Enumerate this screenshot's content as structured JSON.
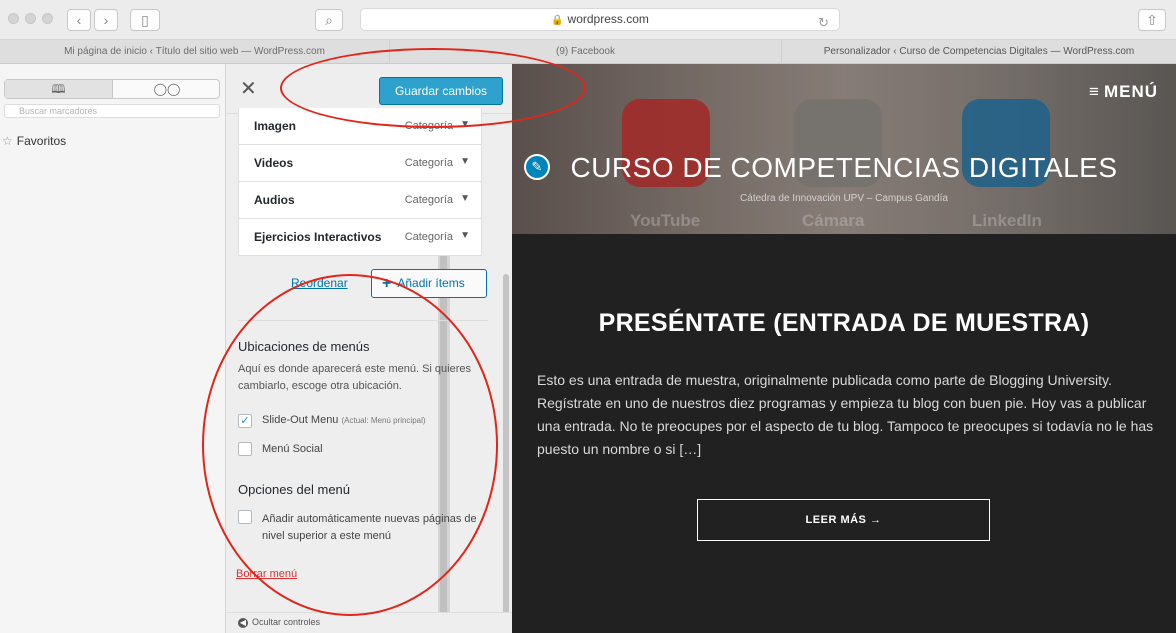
{
  "browser": {
    "address": "wordpress.com",
    "tabs": [
      "Mi página de inicio ‹ Título del sitio web — WordPress.com",
      "(9) Facebook",
      "Personalizador ‹ Curso de Competencias Digitales — WordPress.com"
    ]
  },
  "safari_sidebar": {
    "search_placeholder": "Buscar marcadores",
    "favorites_label": "Favoritos"
  },
  "customizer": {
    "save_label": "Guardar cambios",
    "menu_items": [
      {
        "name": "Imagen",
        "type": "Categoría"
      },
      {
        "name": "Videos",
        "type": "Categoría"
      },
      {
        "name": "Audios",
        "type": "Categoría"
      },
      {
        "name": "Ejercicios Interactivos",
        "type": "Categoría"
      }
    ],
    "reorder_label": "Reordenar",
    "add_items_label": "Añadir ítems",
    "locations": {
      "title": "Ubicaciones de menús",
      "description": "Aquí es donde aparecerá este menú. Si quieres cambiarlo, escoge otra ubicación.",
      "options": [
        {
          "label": "Slide-Out Menu",
          "note": "(Actual: Menú principal)",
          "checked": true
        },
        {
          "label": "Menú Social",
          "note": "",
          "checked": false
        }
      ]
    },
    "menu_options": {
      "title": "Opciones del menú",
      "auto_add_label": "Añadir automáticamente nuevas páginas de nivel superior a este menú",
      "auto_add_checked": false
    },
    "delete_label": "Borrar menú",
    "hide_controls_label": "Ocultar controles"
  },
  "preview": {
    "menu_label": "MENÚ",
    "site_title": "CURSO DE COMPETENCIAS DIGITALES",
    "site_tagline": "Cátedra de Innovación UPV – Campus Gandía",
    "hero_apps": [
      "YouTube",
      "Cámara",
      "LinkedIn"
    ],
    "post_title": "PRESÉNTATE (ENTRADA DE MUESTRA)",
    "excerpt": "Esto es una entrada de muestra, originalmente publicada como parte de Blogging University. Regístrate en uno de nuestros diez programas y empieza tu blog con buen pie. Hoy vas a publicar una entrada. No te preocupes por el aspecto de tu blog. Tampoco te preocupes si todavía no le has puesto un nombre o si […]",
    "read_more": "LEER MÁS →"
  },
  "colors": {
    "wp_blue": "#2ea2cc",
    "annotation_red": "#e0261a",
    "preview_bg": "#212121"
  }
}
